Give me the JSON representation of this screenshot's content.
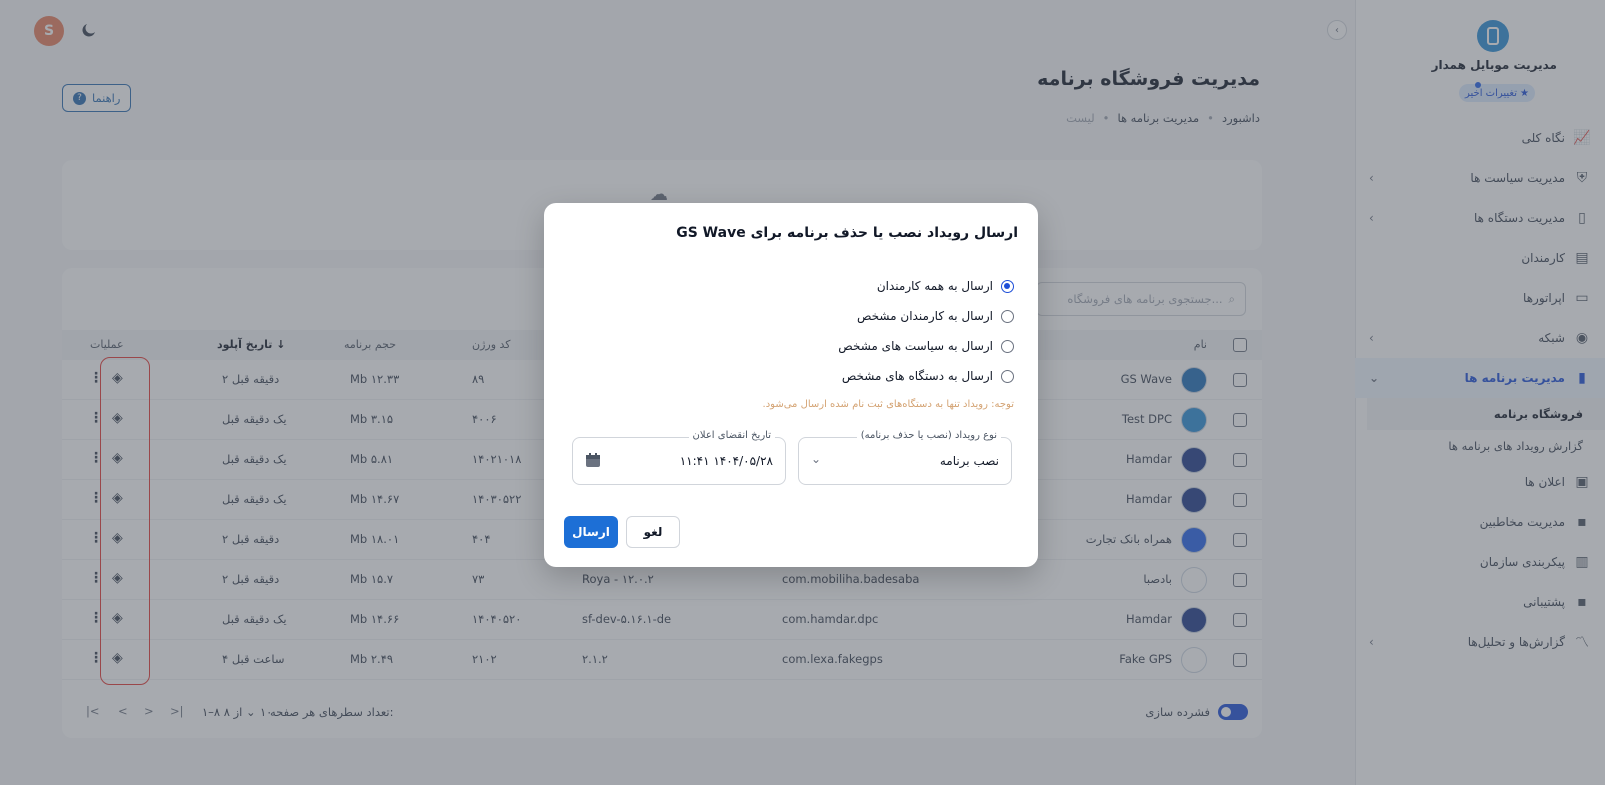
{
  "colors": {
    "accent": "#1d6fd6",
    "highlight": "#e53935",
    "overlay": "rgba(80,85,95,0.5)"
  },
  "user": {
    "avatar_letter": "S"
  },
  "sidebar": {
    "brand": "مدیریت موبایل همدار",
    "recent_changes": "تغییرات اخیر",
    "items": [
      {
        "label": "نگاه کلی",
        "icon": "chart-icon",
        "chevron": false
      },
      {
        "label": "مدیریت سیاست ها",
        "icon": "shield-icon",
        "chevron": true
      },
      {
        "label": "مدیریت دستگاه ها",
        "icon": "phone-icon",
        "chevron": true
      },
      {
        "label": "کارمندان",
        "icon": "badge-icon",
        "chevron": false
      },
      {
        "label": "اپراتورها",
        "icon": "operator-icon",
        "chevron": false
      },
      {
        "label": "شبکه",
        "icon": "network-icon",
        "chevron": true
      },
      {
        "label": "مدیریت برنامه ها",
        "icon": "apps-icon",
        "chevron": true,
        "active": true
      },
      {
        "label": "اعلان ها",
        "icon": "bell-icon",
        "chevron": false
      },
      {
        "label": "مدیریت مخاطبین",
        "icon": "contacts-icon",
        "chevron": false
      },
      {
        "label": "پیکربندی سازمان",
        "icon": "building-icon",
        "chevron": false
      },
      {
        "label": "پشتیبانی",
        "icon": "support-icon",
        "chevron": false
      },
      {
        "label": "گزارش‌ها و تحلیل‌ها",
        "icon": "analytics-icon",
        "chevron": true
      }
    ],
    "subitems": [
      "فروشگاه برنامه",
      "گزارش رویداد های برنامه ها"
    ]
  },
  "header": {
    "title": "مدیریت فروشگاه برنامه",
    "breadcrumb": [
      "داشبورد",
      "مدیریت برنامه ها",
      "لیست"
    ],
    "help": "راهنما"
  },
  "table": {
    "search_placeholder": "جستجوی برنامه های فروشگاه...",
    "columns": {
      "name": "نام",
      "version_code": "کد ورژن",
      "size": "حجم برنامه",
      "upload_date": "تاریخ آپلود",
      "ops": "عملیات"
    },
    "rows": [
      {
        "name": "GS Wave",
        "version": "",
        "package": "",
        "code": "۸۹",
        "size": "Mb ۱۲.۳۳",
        "date": "۲ دقیقه قبل",
        "icon_color": "#1e6fb8"
      },
      {
        "name": "Test DPC",
        "version": "",
        "package": "",
        "code": "۴۰۰۶",
        "size": "Mb ۳.۱۵",
        "date": "یک دقیقه قبل",
        "icon_color": "#2b8fd6"
      },
      {
        "name": "Hamdar",
        "version": "",
        "package": "",
        "code": "۱۴۰۲۱۰۱۸",
        "size": "Mb ۵.۸۱",
        "date": "یک دقیقه قبل",
        "icon_color": "#1e3a8a"
      },
      {
        "name": "Hamdar",
        "version": "",
        "package": "",
        "code": "۱۴۰۳۰۵۲۲",
        "size": "Mb ۱۴.۶۷",
        "date": "یک دقیقه قبل",
        "icon_color": "#1e3a8a"
      },
      {
        "name": "همراه بانک تجارت",
        "version": "",
        "package": "",
        "code": "۴۰۴",
        "size": "Mb ۱۸.۰۱",
        "date": "۲ دقیقه قبل",
        "icon_color": "#2563eb"
      },
      {
        "name": "بادصبا",
        "version": "Roya - ۱۲.۰.۲",
        "package": "com.mobiliha.badesaba",
        "code": "۷۳",
        "size": "Mb ۱۵.۷",
        "date": "۲ دقیقه قبل",
        "icon_color": "#ffffff"
      },
      {
        "name": "Hamdar",
        "version": "sf-dev-۵.۱۶.۱-de",
        "package": "com.hamdar.dpc",
        "code": "۱۴۰۴۰۵۲۰",
        "size": "Mb ۱۴.۶۶",
        "date": "یک دقیقه قبل",
        "icon_color": "#1e3a8a"
      },
      {
        "name": "Fake GPS",
        "version": "۲.۱.۲",
        "package": "com.lexa.fakegps",
        "code": "۲۱۰۲",
        "size": "Mb ۲.۴۹",
        "date": "۴ ساعت قبل",
        "icon_color": "#ffffff"
      }
    ],
    "footer": {
      "dense": "فشرده سازی",
      "rows_per_page_label": "تعداد سطرهای هر صفحه:",
      "rows_per_page": "۱۰",
      "range": "۱–۸ از ۸"
    }
  },
  "modal": {
    "title": "ارسال رویداد نصب یا حذف برنامه برای GS Wave",
    "options": [
      {
        "label": "ارسال به همه کارمندان",
        "selected": true
      },
      {
        "label": "ارسال به کارمندان مشخص",
        "selected": false
      },
      {
        "label": "ارسال به سیاست های مشخص",
        "selected": false
      },
      {
        "label": "ارسال به دستگاه های مشخص",
        "selected": false
      }
    ],
    "note": "توجه: رویداد تنها به دستگاه‌های ثبت نام شده ارسال می‌شود.",
    "event_type_label": "نوع رویداد (نصب یا حذف برنامه)",
    "event_type_value": "نصب برنامه",
    "expiry_label": "تاریخ انقضای اعلان",
    "expiry_value": "۱۴۰۴/۰۵/۲۸ ۱۱:۴۱",
    "send": "ارسال",
    "cancel": "لغو"
  }
}
